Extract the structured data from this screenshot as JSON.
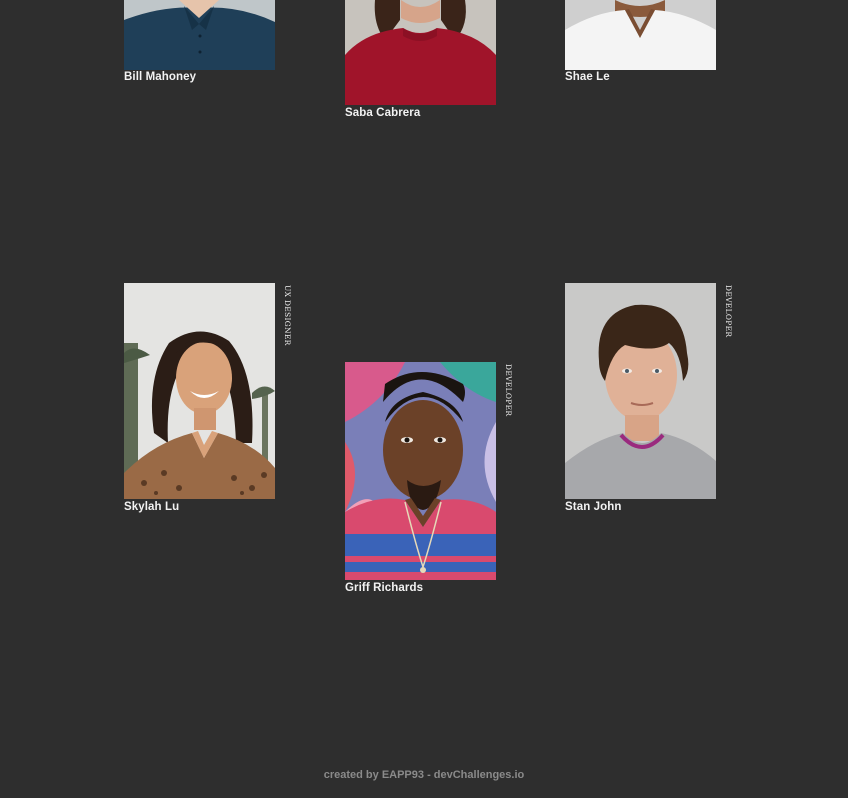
{
  "team": [
    {
      "id": "bill",
      "name": "Bill Mahoney",
      "role": ""
    },
    {
      "id": "saba",
      "name": "Saba Cabrera",
      "role": ""
    },
    {
      "id": "shae",
      "name": "Shae Le",
      "role": ""
    },
    {
      "id": "skylah",
      "name": "Skylah Lu",
      "role": "UX DESIGNER"
    },
    {
      "id": "griff",
      "name": "Griff Richards",
      "role": "DEVELOPER"
    },
    {
      "id": "stan",
      "name": "Stan John",
      "role": "DEVELOPER"
    }
  ],
  "footer": {
    "text": "created by EAPP93 - devChallenges.io"
  },
  "colors": {
    "background": "#2e2e2e",
    "footer_text": "#8a8a8a"
  }
}
